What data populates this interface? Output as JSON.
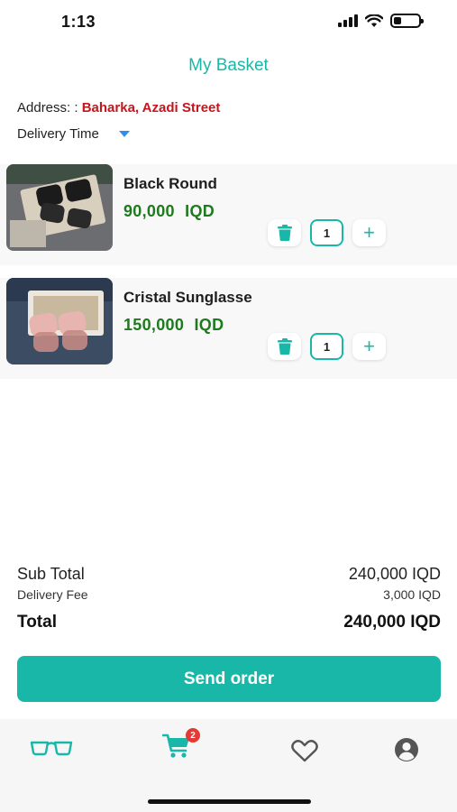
{
  "status_bar": {
    "time": "1:13",
    "battery_level": 0.3
  },
  "header": {
    "title": "My Basket"
  },
  "address": {
    "label": "Address: :",
    "value": "Baharka, Azadi Street"
  },
  "delivery": {
    "label": "Delivery Time"
  },
  "items": [
    {
      "name": "Black Round",
      "price": "90,000",
      "currency": "IQD",
      "quantity": "1"
    },
    {
      "name": "Cristal Sunglasse",
      "price": "150,000",
      "currency": "IQD",
      "quantity": "1"
    }
  ],
  "totals": {
    "sub_total_label": "Sub Total",
    "sub_total_value": "240,000 IQD",
    "delivery_fee_label": "Delivery Fee",
    "delivery_fee_value": "3,000 IQD",
    "total_label": "Total",
    "total_value": "240,000 IQD"
  },
  "actions": {
    "send_order": "Send order"
  },
  "nav": {
    "items": [
      {
        "icon": "glasses-icon"
      },
      {
        "icon": "cart-icon",
        "badge": "2"
      },
      {
        "icon": "heart-icon"
      },
      {
        "icon": "account-icon"
      }
    ]
  },
  "colors": {
    "accent": "#19b7a8",
    "address_value": "#c4161c",
    "price": "#1f7a1f",
    "badge": "#e53935",
    "caret": "#2f8ef0"
  }
}
